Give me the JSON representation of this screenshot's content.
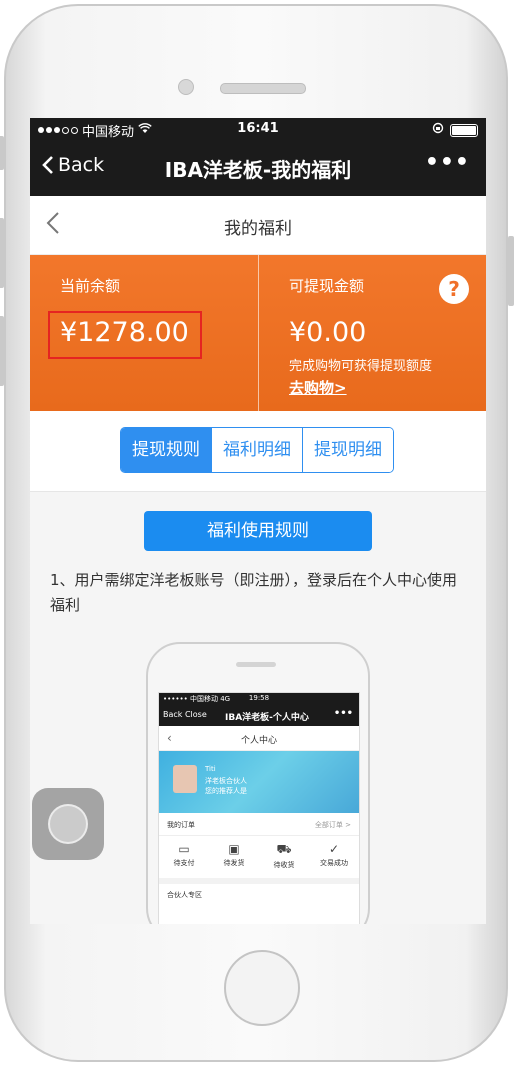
{
  "status_bar": {
    "carrier": "中国移动",
    "time": "16:41"
  },
  "nav": {
    "back_label": "Back",
    "title": "IBA洋老板-我的福利",
    "more_label": "•••"
  },
  "page_header": {
    "title": "我的福利"
  },
  "balance": {
    "current_label": "当前余额",
    "current_amount": "¥1278.00",
    "withdrawable_label": "可提现金额",
    "withdrawable_amount": "¥0.00",
    "withdraw_hint": "完成购物可获得提现额度",
    "shop_link": "去购物>",
    "help_icon": "?"
  },
  "tabs": [
    {
      "label": "提现规则",
      "active": true
    },
    {
      "label": "福利明细",
      "active": false
    },
    {
      "label": "提现明细",
      "active": false
    }
  ],
  "content": {
    "rules_button": "福利使用规则",
    "rule_1": "1、用户需绑定洋老板账号（即注册），登录后在个人中心使用福利"
  },
  "mini_screenshot": {
    "status_left": "•••••• 中国移动  4G",
    "status_time": "19:58",
    "nav_left": "Back  Close",
    "nav_title": "IBA洋老板-个人中心",
    "nav_more": "•••",
    "header": "个人中心",
    "user_name": "Titi",
    "user_role": "洋老板合伙人",
    "user_ref": "您的推荐人是",
    "orders_label": "我的订单",
    "all_orders": "全部订单 >",
    "order_icons": [
      "待支付",
      "待发货",
      "待收货",
      "交易成功"
    ],
    "partner_section": "合伙人专区"
  },
  "colors": {
    "accent_orange": "#f0702a",
    "accent_blue": "#2f8ff0",
    "highlight_red": "#e52421",
    "navbar": "#1b1b1b"
  }
}
